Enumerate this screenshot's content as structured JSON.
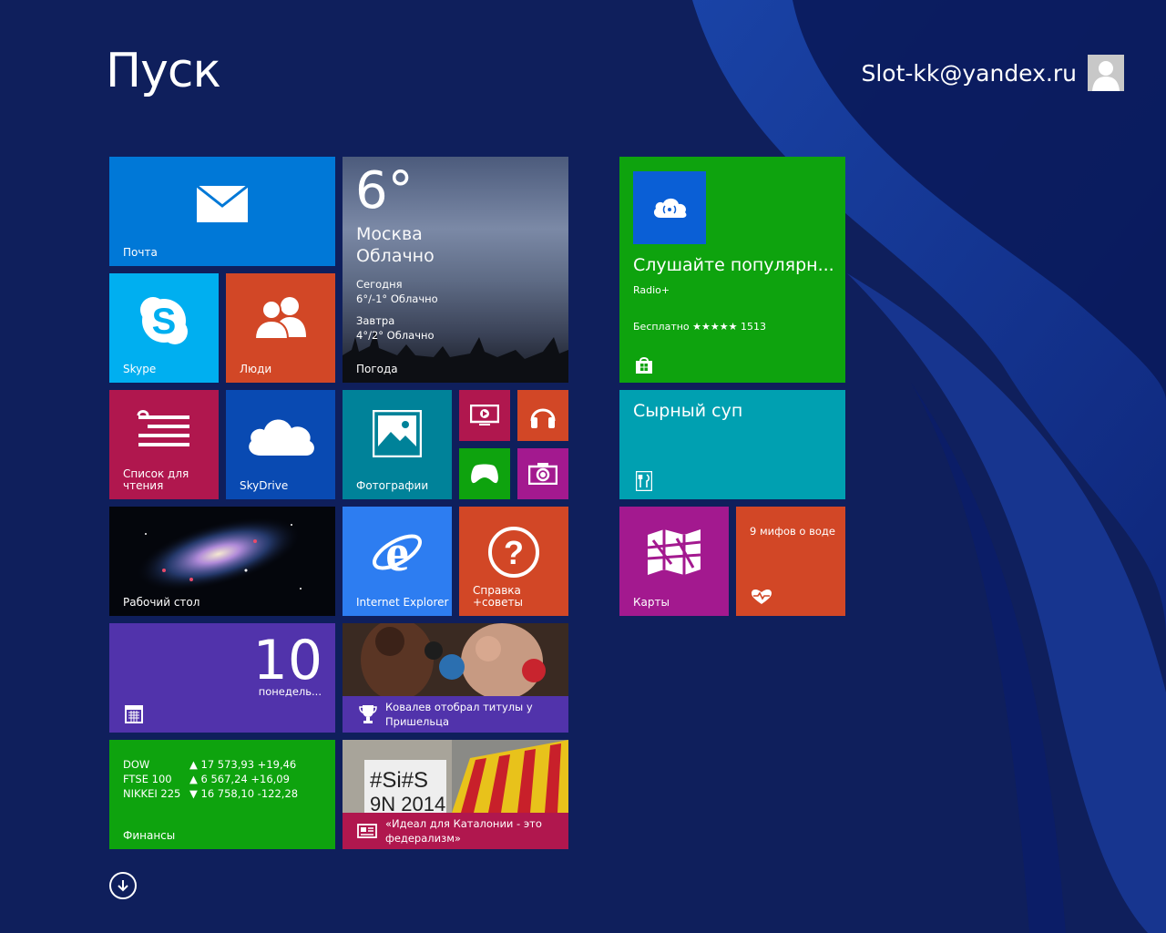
{
  "header": {
    "title": "Пуск",
    "user_name": "Slot-kk@yandex.ru"
  },
  "colors": {
    "background": "#0f1f5c",
    "mail": "#0078d7",
    "skype": "#00aff0",
    "people": "#d24726",
    "reading": "#b0174e",
    "skydrive": "#094ab2",
    "photos": "#008299",
    "video": "#b0174e",
    "music": "#d24726",
    "games": "#0ea30e",
    "camera": "#a3198f",
    "ie": "#2d7df1",
    "help": "#d24726",
    "calendar": "#5133ab",
    "sport": "#5133ab",
    "finance": "#0ea30e",
    "news": "#b0174e",
    "radio": "#0ea30e",
    "food": "#00a0b1",
    "maps": "#a3198f",
    "health": "#d24726"
  },
  "tiles": {
    "mail": {
      "label": "Почта",
      "icon": "envelope-icon"
    },
    "weather": {
      "temp": "6°",
      "city": "Москва",
      "condition": "Облачно",
      "today_label": "Сегодня",
      "today_value": "6°/-1° Облачно",
      "tomorrow_label": "Завтра",
      "tomorrow_value": "4°/2° Облачно",
      "label": "Погода"
    },
    "skype": {
      "label": "Skype",
      "icon": "skype-icon"
    },
    "people": {
      "label": "Люди",
      "icon": "people-icon"
    },
    "reading": {
      "label": "Список для\nчтения",
      "icon": "reading-list-icon"
    },
    "skydrive": {
      "label": "SkyDrive",
      "icon": "cloud-icon"
    },
    "photos": {
      "label": "Фотографии",
      "icon": "photo-icon"
    },
    "video": {
      "icon": "video-icon"
    },
    "music": {
      "icon": "headphones-icon"
    },
    "games": {
      "icon": "gamepad-icon"
    },
    "camera": {
      "icon": "camera-icon"
    },
    "desktop": {
      "label": "Рабочий стол"
    },
    "ie": {
      "label": "Internet Explorer",
      "icon": "internet-explorer-icon"
    },
    "help": {
      "label": "Справка\n+советы",
      "icon": "question-icon"
    },
    "calendar": {
      "number": "10",
      "day": "понедель...",
      "icon": "calendar-icon"
    },
    "sport": {
      "text": "Ковалев отобрал титулы у Пришельца",
      "icon": "trophy-icon"
    },
    "finance": {
      "label": "Финансы",
      "rows": [
        {
          "name": "DOW",
          "value": "▲ 17 573,93 +19,46"
        },
        {
          "name": "FTSE 100",
          "value": "▲ 6 567,24 +16,09"
        },
        {
          "name": "NIKKEI 225",
          "value": "▼ 16 758,10 -122,28"
        }
      ]
    },
    "news": {
      "text": "«Идеал для Каталонии - это федерализм»",
      "icon": "newspaper-icon"
    },
    "radio": {
      "title": "Слушайте популярн...",
      "subtitle": "Radio+",
      "rating": "Бесплатно ★★★★★ 1513",
      "icon": "store-icon"
    },
    "food": {
      "title": "Сырный суп",
      "icon": "cutlery-icon"
    },
    "maps": {
      "label": "Карты",
      "icon": "map-icon"
    },
    "health": {
      "title": "9 мифов о воде",
      "icon": "heart-pulse-icon"
    }
  }
}
